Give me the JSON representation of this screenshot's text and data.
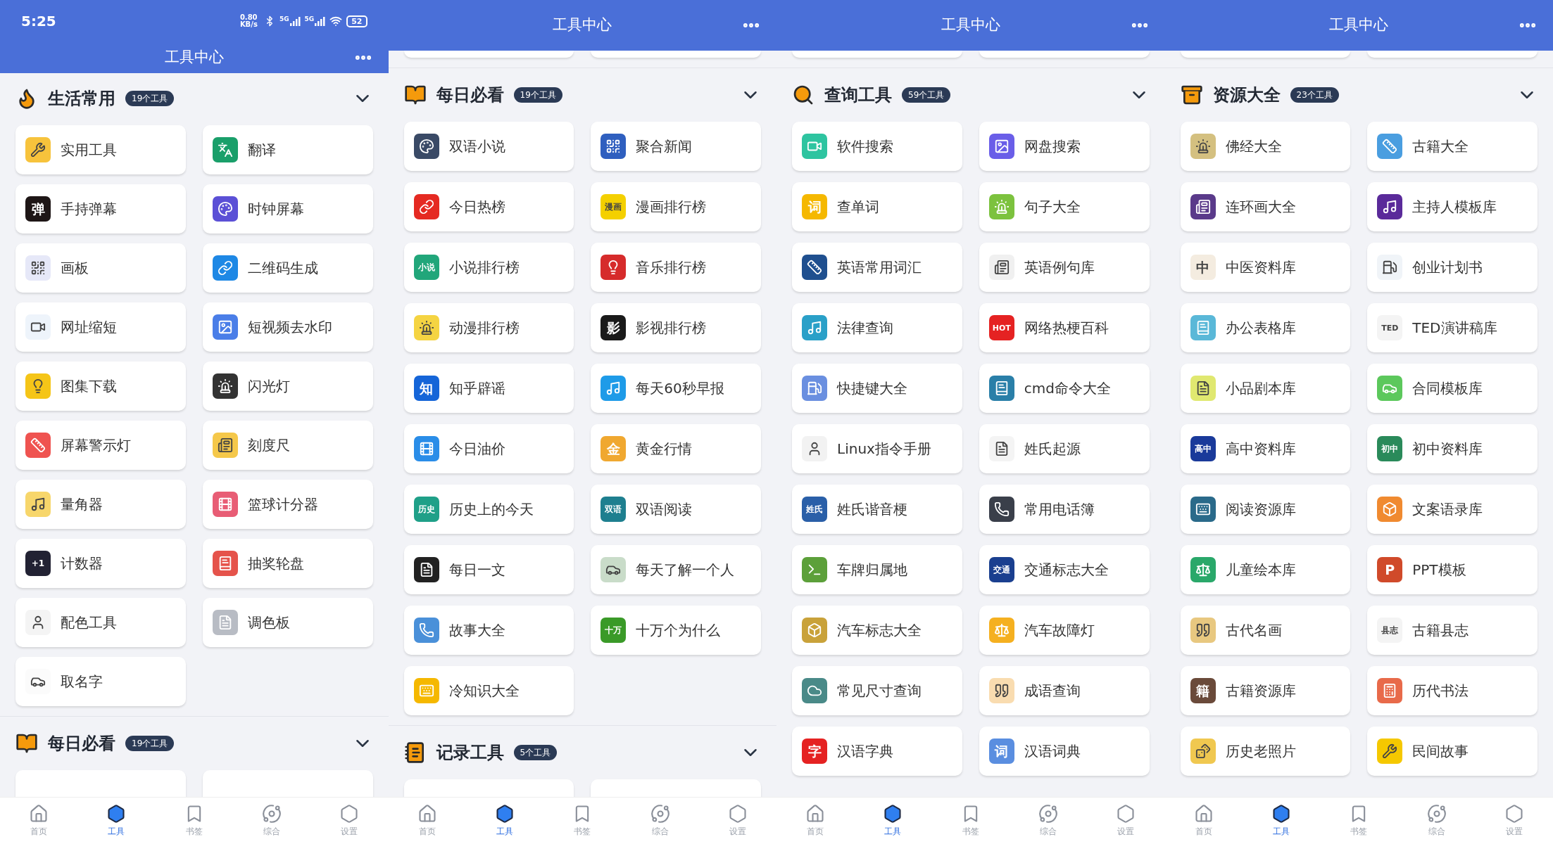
{
  "screens": [
    {
      "status_bar": {
        "time": "5:25",
        "speed": "0.80 KB/s",
        "networks": [
          "5G",
          "5G"
        ],
        "battery": "52"
      },
      "title": "工具中心",
      "sections": [
        {
          "title": "生活常用",
          "count": "19个工具",
          "tools": [
            {
              "name": "实用工具",
              "color": "#f7c33c"
            },
            {
              "name": "翻译",
              "color": "#1a9f6a"
            },
            {
              "name": "手持弹幕",
              "color": "#1e1616",
              "glyph": "弹"
            },
            {
              "name": "时钟屏幕",
              "color": "#5b50d6"
            },
            {
              "name": "画板",
              "color": "#e6e8f8"
            },
            {
              "name": "二维码生成",
              "color": "#1e88e5"
            },
            {
              "name": "网址缩短",
              "color": "#eef4fb"
            },
            {
              "name": "短视频去水印",
              "color": "#4a7ee8"
            },
            {
              "name": "图集下载",
              "color": "#f5c518"
            },
            {
              "name": "闪光灯",
              "color": "#333333"
            },
            {
              "name": "屏幕警示灯",
              "color": "#ef5350"
            },
            {
              "name": "刻度尺",
              "color": "#f5c84a"
            },
            {
              "name": "量角器",
              "color": "#f7d66b"
            },
            {
              "name": "篮球计分器",
              "color": "#e85d75"
            },
            {
              "name": "计数器",
              "color": "#222233",
              "glyph": "+1"
            },
            {
              "name": "抽奖轮盘",
              "color": "#e5534b"
            },
            {
              "name": "配色工具",
              "color": "#f4f4f4"
            },
            {
              "name": "调色板",
              "color": "#b8bcc4"
            },
            {
              "name": "取名字",
              "color": "#fbfbfb"
            }
          ]
        },
        {
          "title": "每日必看",
          "count": "19个工具"
        }
      ],
      "nav": [
        {
          "label": "首页",
          "selected": false
        },
        {
          "label": "工具",
          "selected": true
        },
        {
          "label": "书签",
          "selected": false
        },
        {
          "label": "综合",
          "selected": false
        },
        {
          "label": "设置",
          "selected": false
        }
      ]
    },
    {
      "title": "工具中心",
      "sections": [
        {
          "title": "每日必看",
          "count": "19个工具",
          "tools": [
            {
              "name": "双语小说",
              "color": "#3a4a66"
            },
            {
              "name": "聚合新闻",
              "color": "#2f5fbf"
            },
            {
              "name": "今日热榜",
              "color": "#e52a22"
            },
            {
              "name": "漫画排行榜",
              "color": "#f4d000",
              "glyph": "漫画"
            },
            {
              "name": "小说排行榜",
              "color": "#21a67a",
              "glyph": "小说"
            },
            {
              "name": "音乐排行榜",
              "color": "#d62b2b"
            },
            {
              "name": "动漫排行榜",
              "color": "#f5d442"
            },
            {
              "name": "影视排行榜",
              "color": "#1a1a1a",
              "glyph": "影"
            },
            {
              "name": "知乎辟谣",
              "color": "#1565d8",
              "glyph": "知"
            },
            {
              "name": "每天60秒早报",
              "color": "#1e9be8"
            },
            {
              "name": "今日油价",
              "color": "#2a8de8"
            },
            {
              "name": "黄金行情",
              "color": "#f0a830",
              "glyph": "金"
            },
            {
              "name": "历史上的今天",
              "color": "#1fa088",
              "glyph": "历史"
            },
            {
              "name": "双语阅读",
              "color": "#1e7f8f",
              "glyph": "双语"
            },
            {
              "name": "每日一文",
              "color": "#222222"
            },
            {
              "name": "每天了解一个人",
              "color": "#c9dcc9"
            },
            {
              "name": "故事大全",
              "color": "#4a90d9"
            },
            {
              "name": "十万个为什么",
              "color": "#3a9a28",
              "glyph": "十万"
            },
            {
              "name": "冷知识大全",
              "color": "#f5b800"
            }
          ]
        },
        {
          "title": "记录工具",
          "count": "5个工具"
        }
      ],
      "nav": [
        {
          "label": "首页",
          "selected": false
        },
        {
          "label": "工具",
          "selected": true
        },
        {
          "label": "书签",
          "selected": false
        },
        {
          "label": "综合",
          "selected": false
        },
        {
          "label": "设置",
          "selected": false
        }
      ]
    },
    {
      "title": "工具中心",
      "sections": [
        {
          "title": "查询工具",
          "count": "59个工具",
          "tools": [
            {
              "name": "软件搜索",
              "color": "#2ec4a0"
            },
            {
              "name": "网盘搜索",
              "color": "#6a5ee8"
            },
            {
              "name": "查单词",
              "color": "#f5b800",
              "glyph": "词"
            },
            {
              "name": "句子大全",
              "color": "#7cc23e"
            },
            {
              "name": "英语常用词汇",
              "color": "#1f4f8f"
            },
            {
              "name": "英语例句库",
              "color": "#f0f0f0"
            },
            {
              "name": "法律查询",
              "color": "#2aa0c8"
            },
            {
              "name": "网络热梗百科",
              "color": "#e52222",
              "glyph": "HOT"
            },
            {
              "name": "快捷键大全",
              "color": "#6a8fe0"
            },
            {
              "name": "cmd命令大全",
              "color": "#2a7fa8"
            },
            {
              "name": "Linux指令手册",
              "color": "#f2f2f2"
            },
            {
              "name": "姓氏起源",
              "color": "#f4f4f4"
            },
            {
              "name": "姓氏谐音梗",
              "color": "#2a5fa8",
              "glyph": "姓氏"
            },
            {
              "name": "常用电话簿",
              "color": "#3a3f4a"
            },
            {
              "name": "车牌归属地",
              "color": "#5ca03a"
            },
            {
              "name": "交通标志大全",
              "color": "#1a3f8f",
              "glyph": "交通"
            },
            {
              "name": "汽车标志大全",
              "color": "#c9a23a"
            },
            {
              "name": "汽车故障灯",
              "color": "#f5b020"
            },
            {
              "name": "常见尺寸查询",
              "color": "#4a8a88"
            },
            {
              "name": "成语查询",
              "color": "#f9dcb0"
            },
            {
              "name": "汉语字典",
              "color": "#e52222",
              "glyph": "字"
            },
            {
              "name": "汉语词典",
              "color": "#5a8ee0",
              "glyph": "词"
            }
          ]
        }
      ],
      "nav": [
        {
          "label": "首页",
          "selected": false
        },
        {
          "label": "工具",
          "selected": true
        },
        {
          "label": "书签",
          "selected": false
        },
        {
          "label": "综合",
          "selected": false
        },
        {
          "label": "设置",
          "selected": false
        }
      ]
    },
    {
      "title": "工具中心",
      "sections": [
        {
          "title": "资源大全",
          "count": "23个工具",
          "tools": [
            {
              "name": "佛经大全",
              "color": "#d4c080"
            },
            {
              "name": "古籍大全",
              "color": "#4a9ee0"
            },
            {
              "name": "连环画大全",
              "color": "#5a3a8a"
            },
            {
              "name": "主持人模板库",
              "color": "#5a2a9a"
            },
            {
              "name": "中医资料库",
              "color": "#f4ece0",
              "glyph": "中"
            },
            {
              "name": "创业计划书",
              "color": "#f0f4f8"
            },
            {
              "name": "办公表格库",
              "color": "#5ab8d8"
            },
            {
              "name": "TED演讲稿库",
              "color": "#f4f4f4",
              "glyph": "TED"
            },
            {
              "name": "小品剧本库",
              "color": "#e0e870"
            },
            {
              "name": "合同模板库",
              "color": "#5cc85c"
            },
            {
              "name": "高中资料库",
              "color": "#1a3a9a",
              "glyph": "高中"
            },
            {
              "name": "初中资料库",
              "color": "#2a8a5a",
              "glyph": "初中"
            },
            {
              "name": "阅读资源库",
              "color": "#2a6a8a"
            },
            {
              "name": "文案语录库",
              "color": "#f08a30"
            },
            {
              "name": "儿童绘本库",
              "color": "#2aa86a"
            },
            {
              "name": "PPT模板",
              "color": "#d04a2a",
              "glyph": "P"
            },
            {
              "name": "古代名画",
              "color": "#e8c880"
            },
            {
              "name": "古籍县志",
              "color": "#f4f4f4",
              "glyph": "县志"
            },
            {
              "name": "古籍资源库",
              "color": "#6a4a3a",
              "glyph": "籍"
            },
            {
              "name": "历代书法",
              "color": "#e86a4a"
            },
            {
              "name": "历史老照片",
              "color": "#f0c850"
            },
            {
              "name": "民间故事",
              "color": "#f5c800"
            }
          ]
        }
      ],
      "nav": [
        {
          "label": "首页",
          "selected": false
        },
        {
          "label": "工具",
          "selected": true
        },
        {
          "label": "书签",
          "selected": false
        },
        {
          "label": "综合",
          "selected": false
        },
        {
          "label": "设置",
          "selected": false
        }
      ]
    }
  ]
}
